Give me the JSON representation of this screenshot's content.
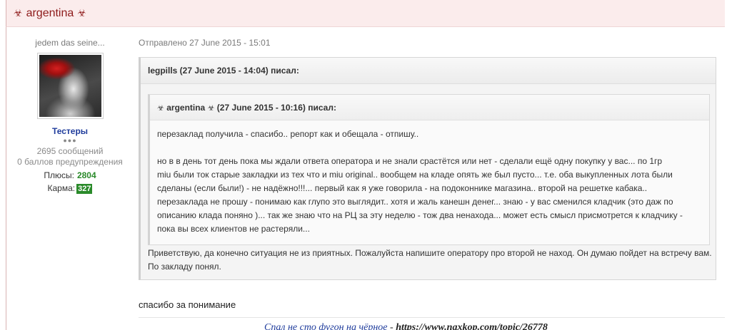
{
  "post": {
    "header_icon_left": "☣",
    "header_icon_right": "☣",
    "author": "argentina",
    "date": "Отправлено 27 June 2015 - 15:01",
    "text": "спасибо за понимание"
  },
  "author_panel": {
    "title": "jedem das seine...",
    "group": "Тестеры",
    "rank_dots": "●●●",
    "posts": "2695 сообщений",
    "warnings": "0 баллов предупреждения",
    "plus_label": "Плюсы:",
    "plus_value": "2804",
    "karma_label": "Карма:",
    "karma_value": "327"
  },
  "quote_outer": {
    "head": "legpills (27 June 2015 - 14:04) писал:",
    "reply_1": "Приветствую, да конечно ситуация не из приятных. Пожалуйста напишите оператору про второй не наход. Он думаю пойдет на встречу вам.",
    "reply_2": "По закладу понял."
  },
  "quote_inner": {
    "head_icon": "☣",
    "head_author": "argentina",
    "head_rest": "(27 June 2015 - 10:16) писал:",
    "line_1": "перезаклад получила - спасибо.. репорт как и обещала - отпишу..",
    "line_2": "но в в день тот день пока мы ждали ответа оператора и не знали срастётся или нет - сделали ещё одну покупку у вас... по 1гр",
    "line_3": "miu  были ток старые закладки из тех что и miu original.. вообщем на кладе опять же был пусто... т.е. оба выкупленных лота были",
    "line_4": "сделаны (если были!) - не надёжно!!!... первый как я уже говорила - на подоконнике магазина.. второй на решетке кабака..",
    "line_5": "перезаклада не прошу - понимаю как глупо это выглядит.. хотя и жаль канешн денег... знаю - у вас сменился кладчик (это даж по",
    "line_6": "описанию клада поняно )... так же знаю что на РЦ за эту неделю - тож два ненахода... может есть смысл присмотрется к кладчику -",
    "line_7": "пока вы всех клиентов не растеряли..."
  },
  "signature": {
    "link_text": "Спал не сто фугон на чёрное",
    "sep": " - ",
    "url": "https://www.naxkop.com/topic/26778"
  },
  "colors": {
    "header_bg": "#fbecec",
    "header_text": "#8e1b1b",
    "group_blue": "#1f3c9c",
    "karma_green": "#2a8a2a"
  }
}
